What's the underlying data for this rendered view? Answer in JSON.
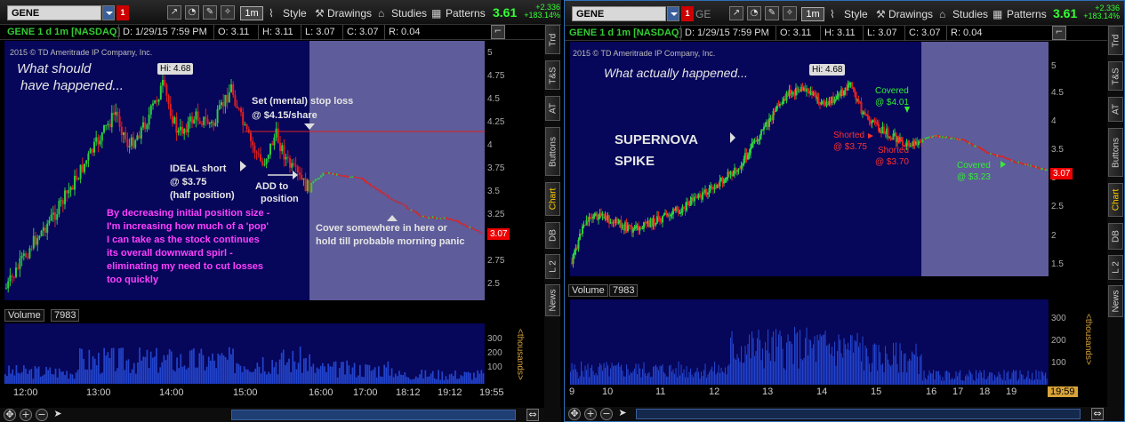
{
  "left_panel": {
    "symbol": "GENE",
    "toolbar": {
      "timeframe": "1m",
      "style": "Style",
      "drawings": "Drawings",
      "studies": "Studies",
      "patterns": "Patterns"
    },
    "last_price": "3.61",
    "change_abs": "+2.336",
    "change_pct": "+183.14%",
    "info": {
      "title": "GENE 1 d 1m [NASDAQ]",
      "date": "D: 1/29/15 7:59 PM",
      "open": "O: 3.11",
      "high": "H: 3.11",
      "low": "L: 3.07",
      "close": "C: 3.07",
      "range": "R: 0.04"
    },
    "copyright": "2015 © TD Ameritrade IP Company, Inc.",
    "y_ticks": [
      "5",
      "4.75",
      "4.5",
      "4.25",
      "4",
      "3.75",
      "3.5",
      "3.25",
      "3",
      "2.75",
      "2.5"
    ],
    "x_ticks": [
      "12:00",
      "13:00",
      "14:00",
      "15:00",
      "16:00",
      "17:00",
      "18:12",
      "19:12",
      "19:55"
    ],
    "hi_label": "Hi: 4.68",
    "last_badge": "3.07",
    "volume": {
      "label": "Volume",
      "value": "7983",
      "ticks": [
        "300",
        "200",
        "100"
      ],
      "axis_label": "<thousands>"
    },
    "annotations": {
      "heading": [
        "What should",
        "have happened..."
      ],
      "stop": [
        "Set (mental) stop loss",
        "@ $4.15/share"
      ],
      "ideal": [
        "IDEAL short",
        "@ $3.75",
        "(half position)"
      ],
      "add": [
        "ADD to",
        "position"
      ],
      "cover": [
        "Cover somewhere in here or",
        "hold till probable morning panic"
      ],
      "strategy": [
        "By decreasing initial position size -",
        "I'm increasing how much of a 'pop'",
        "I can take as the stock continues",
        "its overall downward spirl -",
        "eliminating my need to cut losses",
        "too quickly"
      ]
    }
  },
  "right_panel": {
    "symbol": "GENE",
    "symbol_extra": "GE",
    "toolbar": {
      "timeframe": "1m",
      "style": "Style",
      "drawings": "Drawings",
      "studies": "Studies",
      "patterns": "Patterns"
    },
    "last_price": "3.61",
    "change_abs": "+2.336",
    "change_pct": "+183.14%",
    "info": {
      "title": "GENE 1 d 1m [NASDAQ]",
      "date": "D: 1/29/15 7:59 PM",
      "open": "O: 3.11",
      "high": "H: 3.11",
      "low": "L: 3.07",
      "close": "C: 3.07",
      "range": "R: 0.04"
    },
    "copyright": "2015 © TD Ameritrade IP Company, Inc.",
    "y_ticks": [
      "5",
      "4.5",
      "4",
      "3.5",
      "3",
      "2.5",
      "2",
      "1.5"
    ],
    "x_ticks": [
      "9",
      "10",
      "11",
      "12",
      "13",
      "14",
      "15",
      "16",
      "17",
      "18",
      "19"
    ],
    "time_badge": "19:59",
    "hi_label": "Hi: 4.68",
    "last_badge": "3.07",
    "volume": {
      "label": "Volume",
      "value": "7983",
      "ticks": [
        "300",
        "200",
        "100"
      ],
      "axis_label": "<thousands>"
    },
    "annotations": {
      "heading": "What actually happened...",
      "spike": [
        "SUPERNOVA",
        "SPIKE"
      ],
      "covered1": [
        "Covered",
        "@ $4.01"
      ],
      "shorted1": [
        "Shorted",
        "@ $3.75"
      ],
      "shorted2": [
        "Shorted",
        "@ $3.70"
      ],
      "covered2": [
        "Covered",
        "@ $3.23"
      ]
    }
  },
  "side_tabs": [
    "Trd",
    "T&S",
    "AT",
    "Buttons",
    "Chart",
    "DB",
    "L 2",
    "News"
  ],
  "colors": {
    "chart_bg": "#06065a",
    "after_hours_bg": "#5e5c9a",
    "up_candle": "#2ecc40",
    "down_candle": "#e02020",
    "volume_bar": "#2244cc",
    "price_green": "#33ff33",
    "annotation_white": "#e6e6e6",
    "annotation_magenta": "#ff40ff",
    "annotation_red": "#ff3030",
    "annotation_green": "#33ee33"
  }
}
